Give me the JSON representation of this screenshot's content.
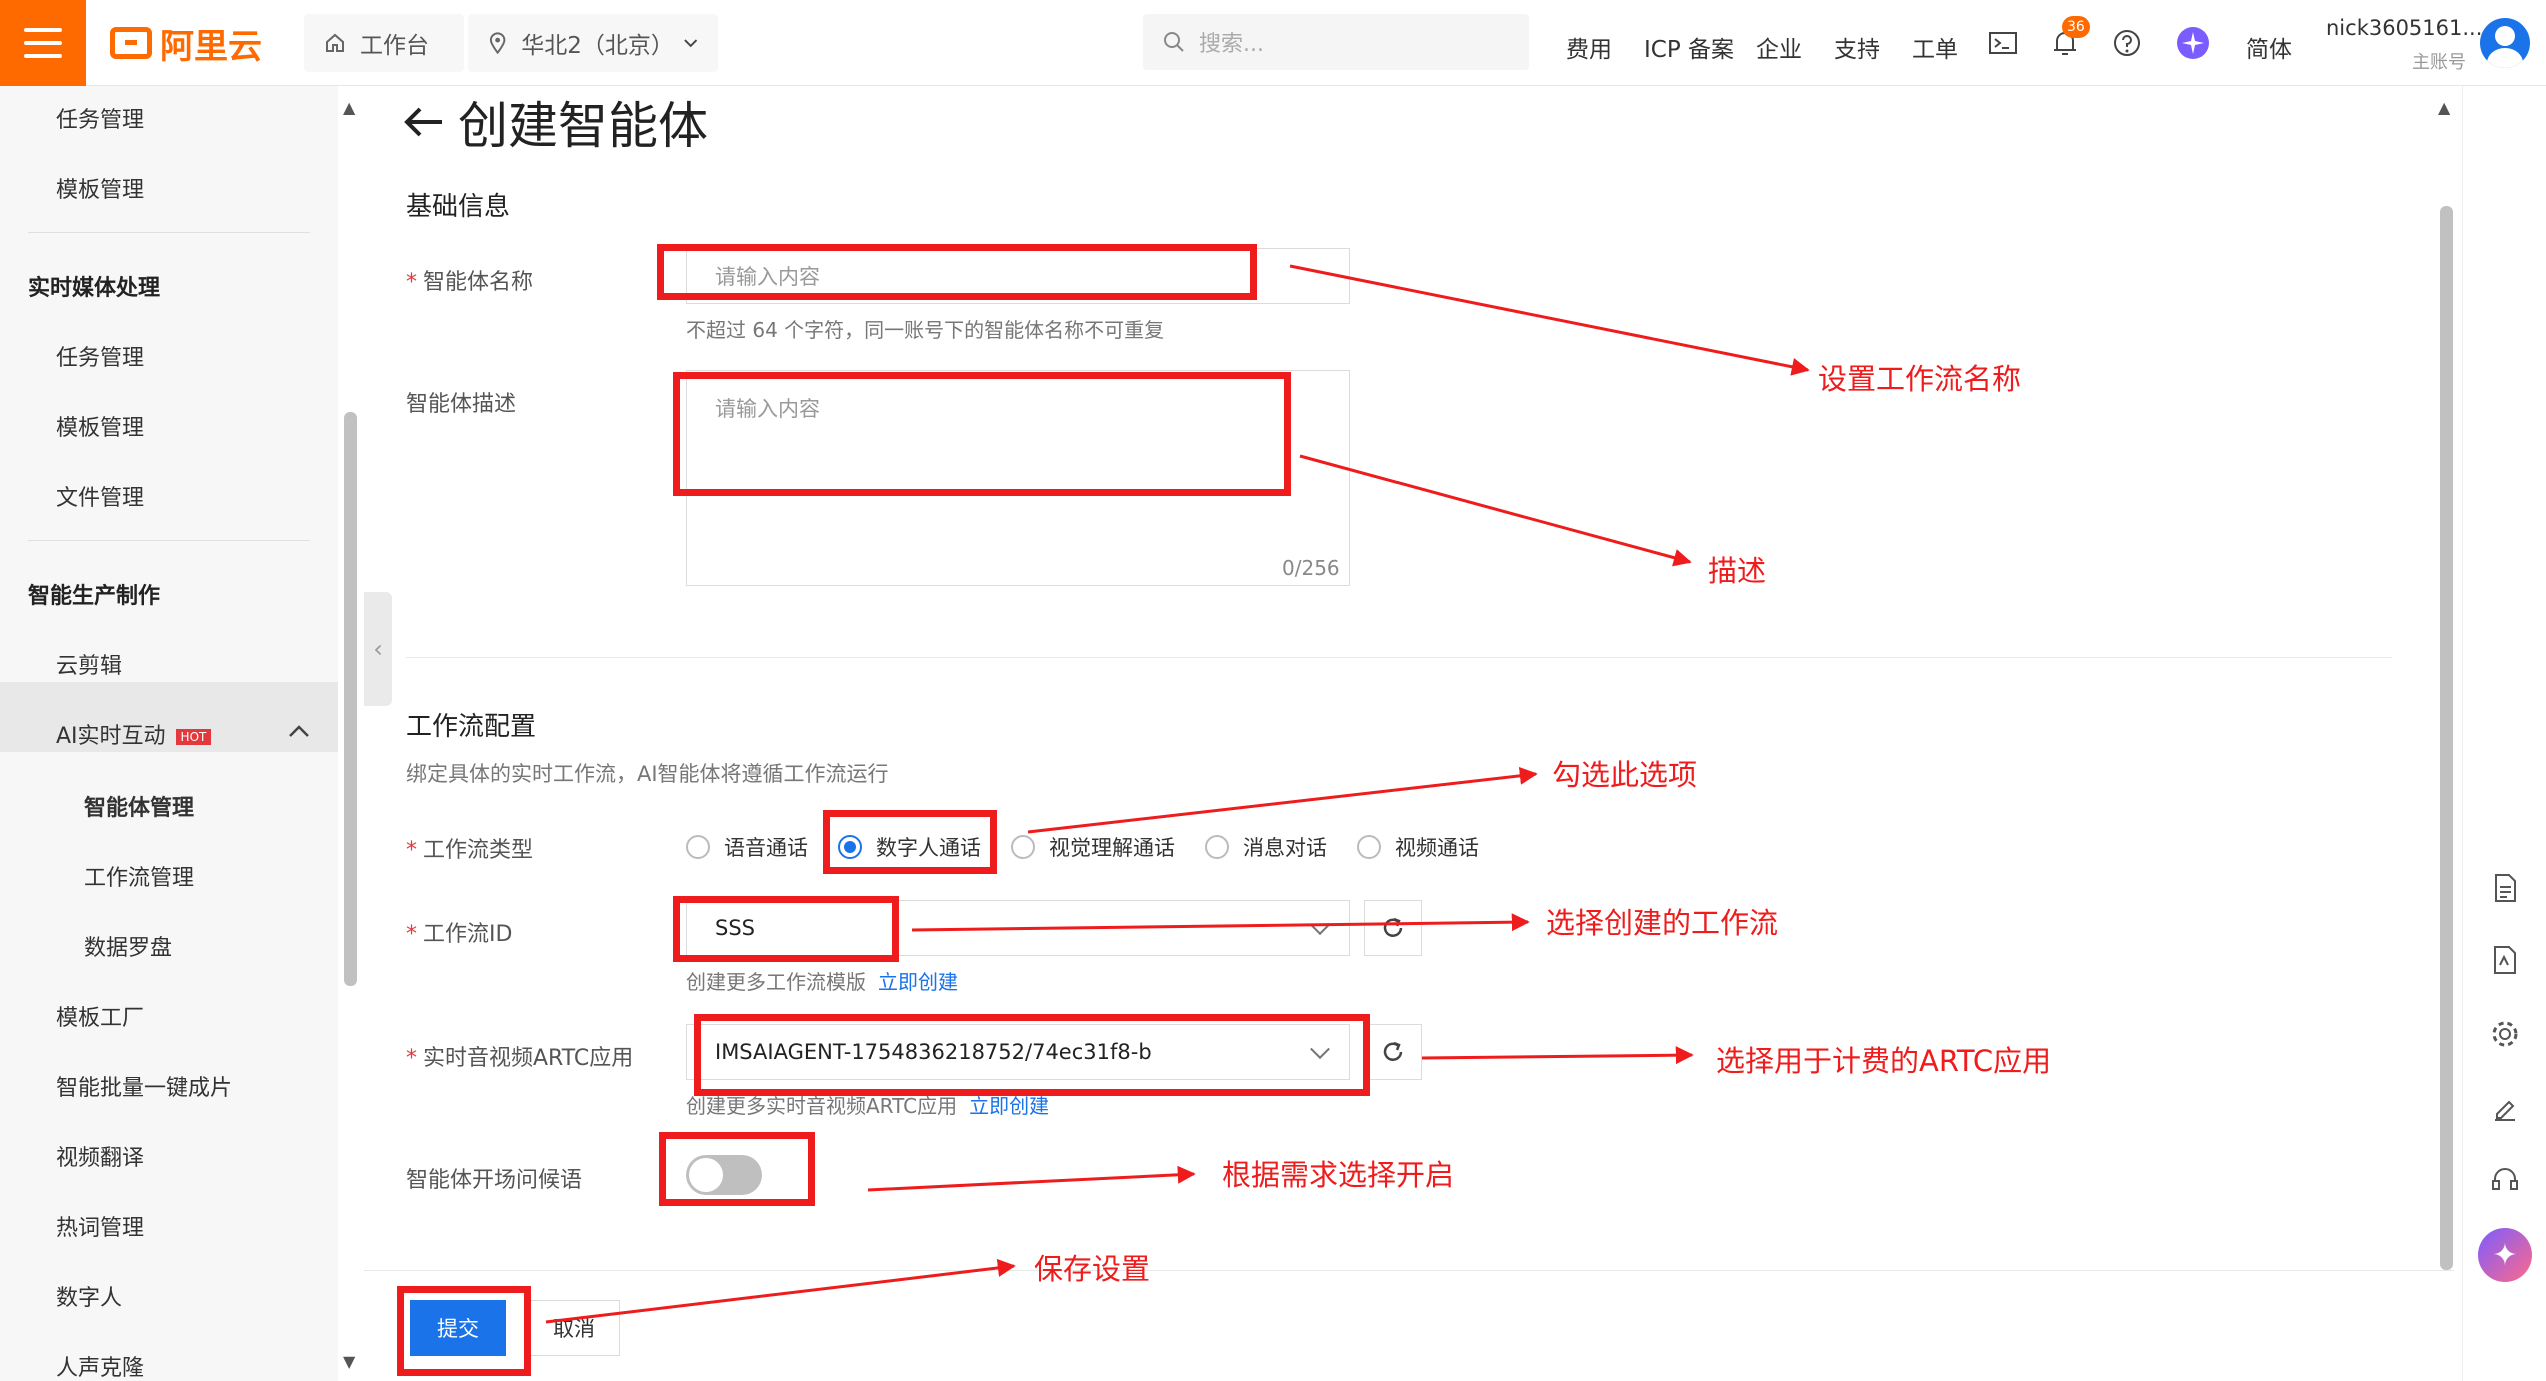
{
  "topbar": {
    "brand": "阿里云",
    "workbench": "工作台",
    "region": "华北2（北京）",
    "search_placeholder": "搜索...",
    "nav": [
      "费用",
      "ICP 备案",
      "企业",
      "支持",
      "工单"
    ],
    "notification_count": "36",
    "language": "简体",
    "username": "nick3605161...",
    "role": "主账号"
  },
  "sidebar": {
    "items_top": [
      "任务管理",
      "模板管理"
    ],
    "group_media": "实时媒体处理",
    "media_items": [
      "任务管理",
      "模板管理",
      "文件管理"
    ],
    "group_smart": "智能生产制作",
    "smart_item_cloud_edit": "云剪辑",
    "ai_realtime": "AI实时互动",
    "hot_badge": "HOT",
    "ai_sub_items": [
      "智能体管理",
      "工作流管理",
      "数据罗盘"
    ],
    "bottom_items": [
      "模板工厂",
      "智能批量一键成片",
      "视频翻译",
      "热词管理",
      "数字人",
      "人声克隆"
    ]
  },
  "page": {
    "title": "创建智能体",
    "basic_section": "基础信息",
    "name_label": "智能体名称",
    "name_placeholder": "请输入内容",
    "name_hint": "不超过 64 个字符，同一账号下的智能体名称不可重复",
    "desc_label": "智能体描述",
    "desc_placeholder": "请输入内容",
    "desc_counter": "0/256",
    "workflow_section": "工作流配置",
    "workflow_desc": "绑定具体的实时工作流，AI智能体将遵循工作流运行",
    "workflow_type_label": "工作流类型",
    "workflow_types": [
      "语音通话",
      "数字人通话",
      "视觉理解通话",
      "消息对话",
      "视频通话"
    ],
    "workflow_type_selected": "数字人通话",
    "workflow_id_label": "工作流ID",
    "workflow_id_value": "SSS",
    "workflow_hint": "创建更多工作流模版",
    "workflow_hint_link": "立即创建",
    "artc_label": "实时音视频ARTC应用",
    "artc_value": "IMSAIAGENT-1754836218752/74ec31f8-b",
    "artc_hint": "创建更多实时音视频ARTC应用",
    "artc_hint_link": "立即创建",
    "greeting_label": "智能体开场问候语",
    "greeting_enabled": false,
    "submit": "提交",
    "cancel": "取消"
  },
  "annotations": {
    "name": "设置工作流名称",
    "desc": "描述",
    "type": "勾选此选项",
    "workflow": "选择创建的工作流",
    "artc": "选择用于计费的ARTC应用",
    "greeting": "根据需求选择开启",
    "save": "保存设置"
  },
  "colors": {
    "brand": "#ff6a00",
    "primary": "#1a73e8",
    "annotation": "#ee1c1c"
  }
}
